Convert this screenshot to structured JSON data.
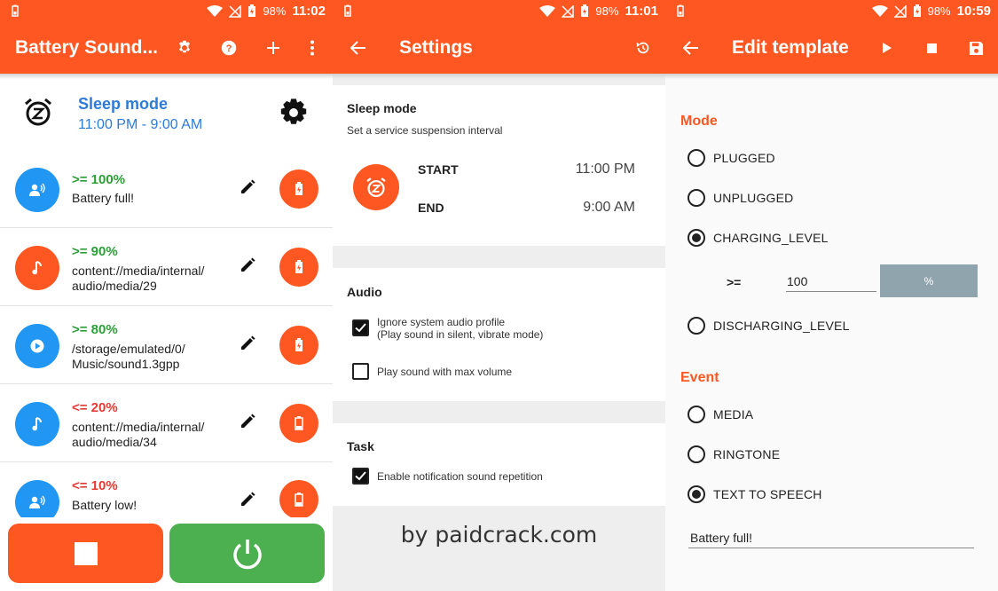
{
  "screen1": {
    "status": {
      "battery": "98%",
      "time": "11:02"
    },
    "appbar": {
      "title": "Battery Sound..."
    },
    "sleep": {
      "title": "Sleep mode",
      "time_range": "11:00 PM - 9:00 AM"
    },
    "items": [
      {
        "level": ">= 100%",
        "text": "Battery full!",
        "level_color": "#2e9e3a",
        "icon_color": "#2196f3",
        "icon": "speaker-voice-icon"
      },
      {
        "level": ">= 90%",
        "text": "content://media/internal/\naudio/media/29",
        "level_color": "#2e9e3a",
        "icon_color": "#ff5722",
        "icon": "music-note-icon"
      },
      {
        "level": ">= 80%",
        "text": "/storage/emulated/0/\nMusic/sound1.3gpp",
        "level_color": "#2e9e3a",
        "icon_color": "#2196f3",
        "icon": "play-icon"
      },
      {
        "level": "<= 20%",
        "text": "content://media/internal/\naudio/media/34",
        "level_color": "#e53935",
        "icon_color": "#2196f3",
        "icon": "music-note-icon"
      },
      {
        "level": "<= 10%",
        "text": "Battery low!",
        "level_color": "#e53935",
        "icon_color": "#2196f3",
        "icon": "speaker-voice-icon"
      }
    ]
  },
  "screen2": {
    "status": {
      "battery": "98%",
      "time": "11:01"
    },
    "appbar": {
      "title": "Settings"
    },
    "sleep": {
      "title": "Sleep mode",
      "subtitle": "Set a service suspension interval",
      "start_label": "START",
      "start_value": "11:00 PM",
      "end_label": "END",
      "end_value": "9:00 AM"
    },
    "audio": {
      "title": "Audio",
      "opt1_line1": "Ignore system audio profile",
      "opt1_line2": "(Play sound in silent, vibrate mode)",
      "opt2": "Play sound with max volume"
    },
    "task": {
      "title": "Task",
      "opt1": "Enable notification sound repetition"
    },
    "watermark": "by paidcrack.com"
  },
  "screen3": {
    "status": {
      "battery": "98%",
      "time": "10:59"
    },
    "appbar": {
      "title": "Edit template"
    },
    "mode": {
      "title": "Mode",
      "options": [
        "PLUGGED",
        "UNPLUGGED",
        "CHARGING_LEVEL",
        "DISCHARGING_LEVEL"
      ],
      "selected": "CHARGING_LEVEL"
    },
    "threshold": {
      "operator": ">=",
      "value": "100",
      "unit": "%"
    },
    "event": {
      "title": "Event",
      "options": [
        "MEDIA",
        "RINGTONE",
        "TEXT TO SPEECH"
      ],
      "selected": "TEXT TO SPEECH"
    },
    "tts_text": "Battery full!"
  },
  "colors": {
    "accent": "#ff5722",
    "blue": "#2196f3",
    "green": "#4caf50",
    "title_blue": "#2e7bd6"
  }
}
